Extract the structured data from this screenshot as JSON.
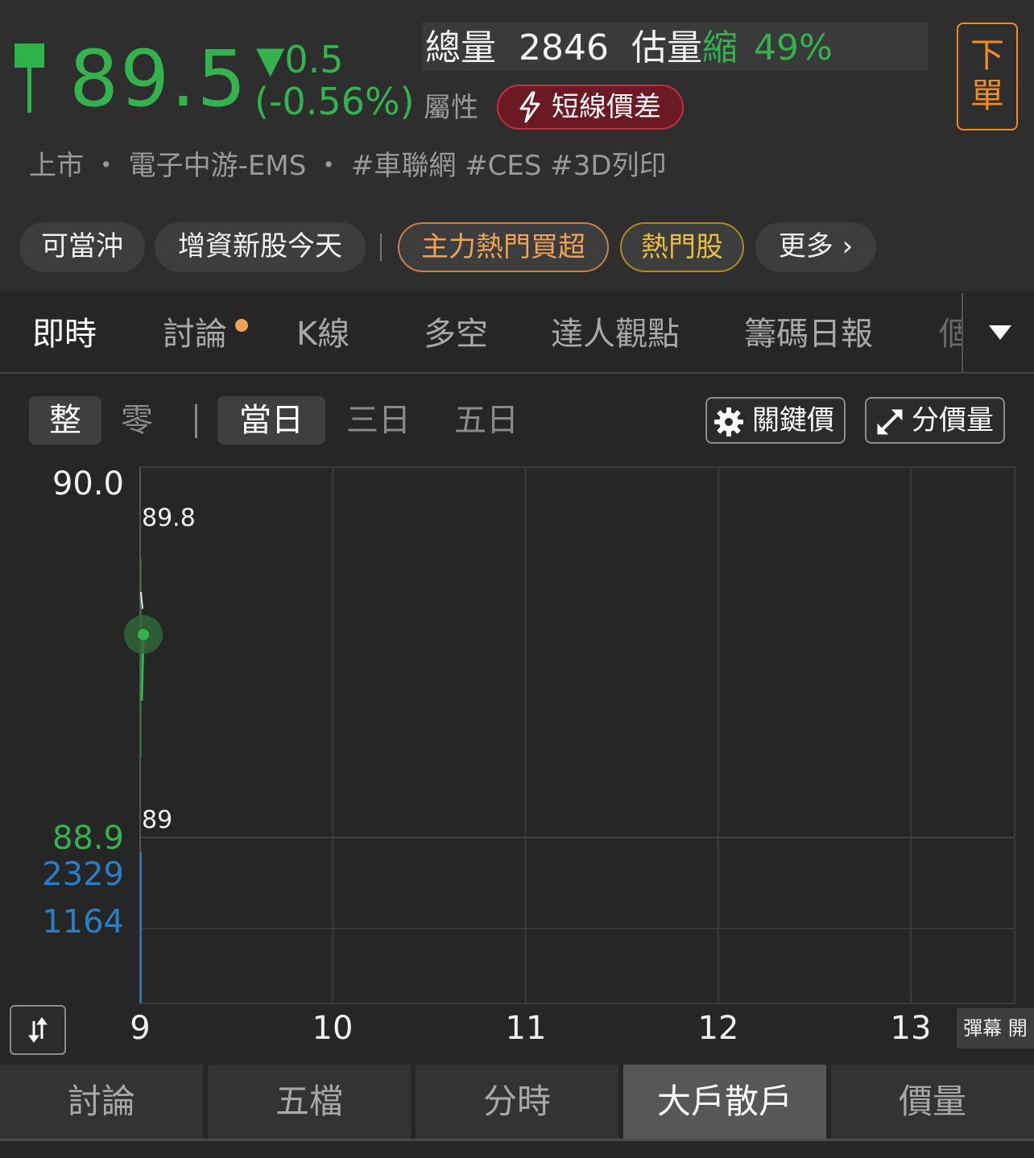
{
  "quote": {
    "price": "89.5",
    "change": "▼0.5",
    "change_pct": "(-0.56%)",
    "color_down": "#33b24e"
  },
  "volume": {
    "total_label": "總量",
    "total_value": "2846",
    "est_label": "估量",
    "est_status": "縮",
    "est_pct": "49%"
  },
  "attribute": {
    "label": "屬性",
    "badge": "短線價差",
    "badge_icon": "lightning-icon"
  },
  "order_button": {
    "line1": "下",
    "line2": "單"
  },
  "tagline": "上市 ・ 電子中游-EMS ・ #車聯網  #CES  #3D列印",
  "chips": [
    {
      "label": "可當沖"
    },
    {
      "label": "增資新股今天"
    },
    {
      "label": "主力熱門買超"
    },
    {
      "label": "熱門股"
    },
    {
      "label": "更多 ›"
    }
  ],
  "tabs": [
    {
      "label": "即時"
    },
    {
      "label": "討論"
    },
    {
      "label": "K線"
    },
    {
      "label": "多空"
    },
    {
      "label": "達人觀點"
    },
    {
      "label": "籌碼日報"
    },
    {
      "label": "個"
    }
  ],
  "segments": {
    "lot": [
      "整",
      "零"
    ],
    "range": [
      "當日",
      "三日",
      "五日"
    ]
  },
  "tools": {
    "key_price": "關鍵價",
    "price_volume": "分價量"
  },
  "danmu_label": "彈幕 開",
  "bottom_nav": [
    {
      "label": "討論"
    },
    {
      "label": "五檔"
    },
    {
      "label": "分時"
    },
    {
      "label": "大戶散戶"
    },
    {
      "label": "價量"
    }
  ],
  "chart_data": {
    "type": "line",
    "y_price_labels": [
      "90.0",
      "88.9"
    ],
    "y_volume_labels": [
      "2329",
      "1164"
    ],
    "x_labels": [
      "9",
      "10",
      "11",
      "12",
      "13"
    ],
    "high_annotation": "89.8",
    "low_annotation": "89",
    "price_range": [
      88.9,
      90.0
    ],
    "volume_range": [
      0,
      2329
    ],
    "series": [
      {
        "x": [
          "9:00",
          "9:01",
          "9:02"
        ],
        "values": [
          89.4,
          89.8,
          89.5
        ]
      }
    ],
    "current_point": {
      "x": "9:02",
      "value": 89.5
    },
    "colors": {
      "price_up": "#e8e8e8",
      "price_down": "#33b24e",
      "volume": "#2a7fc4"
    }
  }
}
